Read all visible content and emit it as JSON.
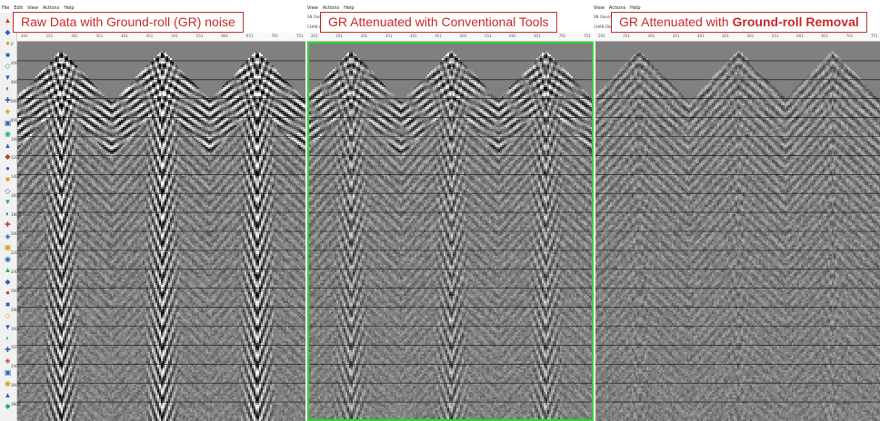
{
  "windows": [
    {
      "menu": [
        "File",
        "Edit",
        "View",
        "Actions",
        "Help"
      ],
      "axis_ticks": [
        "201",
        "251",
        "301",
        "351",
        "401",
        "451",
        "501",
        "551",
        "601",
        "651",
        "701",
        "751"
      ]
    },
    {
      "menu": [
        "View",
        "Actions",
        "Help"
      ],
      "info": [
        "SN (Source",
        "CHAN (Recei"
      ],
      "axis_ticks": [
        "201",
        "251",
        "301",
        "351",
        "401",
        "451",
        "501",
        "551",
        "601",
        "651",
        "701",
        "751"
      ]
    },
    {
      "menu": [
        "View",
        "Actions",
        "Help"
      ],
      "info": [
        "SN (Source",
        "CHAN (Recei"
      ],
      "axis_ticks": [
        "201",
        "251",
        "301",
        "351",
        "401",
        "451",
        "501",
        "551",
        "601",
        "651",
        "701",
        "751"
      ]
    }
  ],
  "time_axis": [
    "0",
    "200",
    "400",
    "600",
    "800",
    "1000",
    "1200",
    "1400",
    "1600",
    "1800",
    "2000",
    "2200",
    "2400",
    "2600",
    "2800",
    "3000",
    "3200",
    "3400",
    "3600",
    "3800"
  ],
  "labels": {
    "raw": "Raw Data with Ground-roll (GR) noise",
    "conventional": "GR Attenuated with Conventional Tools",
    "removal_prefix": "GR Attenuated with ",
    "removal_bold": "Ground-roll Removal"
  },
  "colors": {
    "label_border": "#c92a2a",
    "selection": "#2ed52e"
  },
  "panels": [
    {
      "noise": 0.95,
      "cone_strength": 1.0
    },
    {
      "noise": 0.55,
      "cone_strength": 0.75
    },
    {
      "noise": 0.15,
      "cone_strength": 0.15
    }
  ]
}
